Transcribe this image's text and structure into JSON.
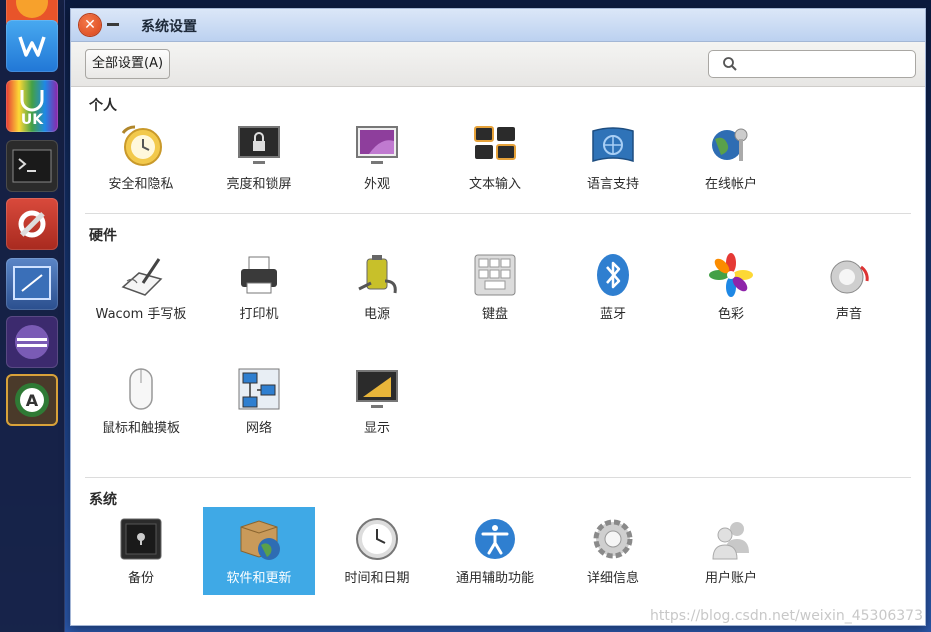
{
  "window": {
    "title": "系统设置"
  },
  "toolbar": {
    "all_settings": "全部设置(A)",
    "search_placeholder": ""
  },
  "sections": {
    "personal": {
      "title": "个人",
      "items": [
        "安全和隐私",
        "亮度和锁屏",
        "外观",
        "文本输入",
        "语言支持",
        "在线帐户"
      ]
    },
    "hardware": {
      "title": "硬件",
      "items": [
        "Wacom 手写板",
        "打印机",
        "电源",
        "键盘",
        "蓝牙",
        "色彩",
        "声音",
        "鼠标和触摸板",
        "网络",
        "显示"
      ]
    },
    "system": {
      "title": "系统",
      "items": [
        "备份",
        "软件和更新",
        "时间和日期",
        "通用辅助功能",
        "详细信息",
        "用户账户"
      ],
      "selected": "软件和更新"
    }
  },
  "launcher": {
    "items": [
      "firefox-icon",
      "wps-icon",
      "ubuntu-kylin-icon",
      "terminal-icon",
      "system-settings-icon",
      "remote-desktop-icon",
      "eclipse-icon",
      "software-updater-icon"
    ]
  },
  "watermark": "https://blog.csdn.net/weixin_45306373",
  "colors": {
    "selection": "#3fa9e6",
    "close": "#e2551f",
    "titlebar": "#c9dbf4"
  }
}
